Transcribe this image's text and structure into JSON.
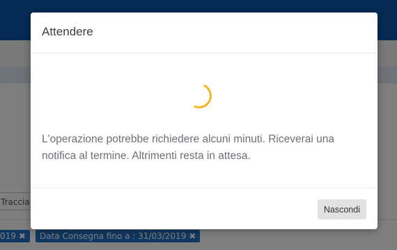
{
  "background": {
    "tracciamento_label": "Traccia",
    "tags": [
      {
        "label": "019",
        "close_icon": "x-icon"
      },
      {
        "label": "Data Consegna fino a : 31/03/2019",
        "close_icon": "x-icon"
      }
    ]
  },
  "modal": {
    "title": "Attendere",
    "message": "L'operazione potrebbe richiedere alcuni minuti. Riceverai una notifica al termine. Altrimenti resta in attesa.",
    "spinner_icon": "loading-spinner-icon",
    "hide_button_label": "Nascondi"
  },
  "colors": {
    "header_blue": "#0d57a8",
    "tag_blue": "#2170c5",
    "spinner_yellow": "#f5b324",
    "button_gray": "#e1e1e1"
  }
}
